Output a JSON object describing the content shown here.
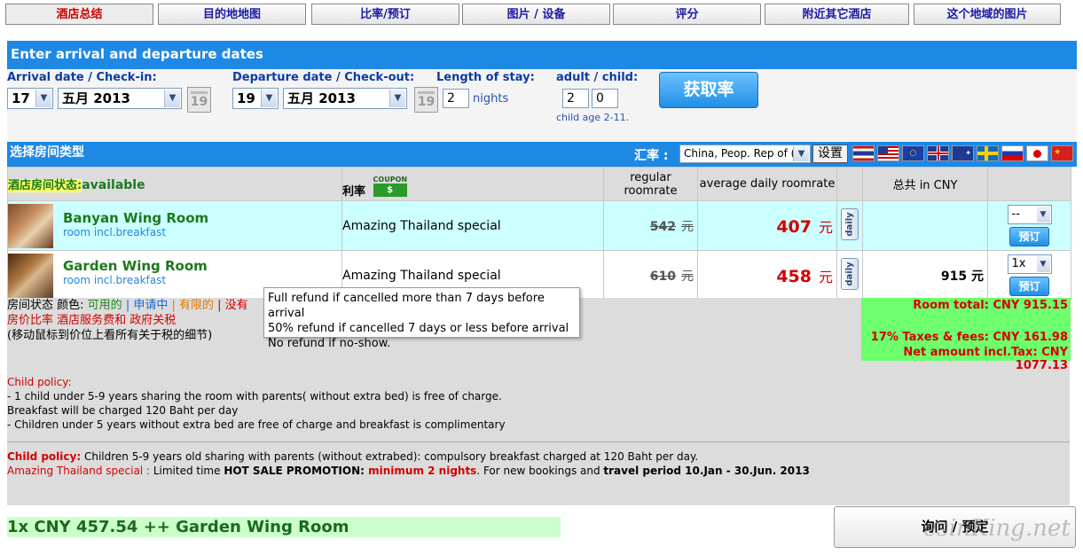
{
  "tabs": [
    "酒店总结",
    "目的地地图",
    "比率/预订",
    "图片 / 设备",
    "评分",
    "附近其它酒店",
    "这个地域的图片"
  ],
  "dates_header": "Enter arrival and departure dates",
  "arrival": {
    "label": "Arrival date / Check-in:",
    "day": "17",
    "month_year": "五月 2013",
    "cal_day": "19"
  },
  "departure": {
    "label": "Departure date / Check-out:",
    "day": "19",
    "month_year": "五月 2013",
    "cal_day": "19"
  },
  "stay": {
    "label": "Length of stay:",
    "value": "2",
    "unit": "nights"
  },
  "guests": {
    "label": "adult / child:",
    "adults": "2",
    "children": "0",
    "note": "child age 2-11."
  },
  "get_rate_button": "获取率",
  "room_type_header": "选择房间类型",
  "currency": {
    "label": "汇率 :",
    "selected": "China, Peop. Rep of (¥)",
    "set_button": "设置"
  },
  "table": {
    "status_label": "酒店房间状态:",
    "status_value": "available",
    "rate_label": "利率",
    "coupon": "COUPON",
    "regular": "regular roomrate",
    "average": "average daily roomrate",
    "total": "总共  in CNY"
  },
  "rooms": [
    {
      "name": "Banyan Wing Room",
      "sub": "room incl.breakfast",
      "rate": "Amazing Thailand special",
      "regular": "542",
      "currency_unit": "元",
      "avg": "407",
      "daily": "daily",
      "total": "",
      "qty": "--",
      "book": "预订"
    },
    {
      "name": "Garden Wing Room",
      "sub": "room incl.breakfast",
      "rate": "Amazing Thailand special",
      "regular": "610",
      "currency_unit": "元",
      "avg": "458",
      "daily": "daily",
      "total": "915 元",
      "qty": "1x",
      "book": "预订"
    }
  ],
  "legend": {
    "status": "房间状态 颜色:",
    "available": "可用的",
    "request": "| 申请中",
    "limited": "| 有限的",
    "none": "| 没有",
    "line2": "房价比率 酒店服务费和 政府关税",
    "line3": "(移动鼠标到价位上看所有关于税的细节)"
  },
  "tooltip": [
    "Full refund if cancelled more than 7 days before arrival",
    "50% refund if cancelled 7 days or less before arrival",
    "No refund if no-show."
  ],
  "totals": {
    "room_total": "Room total: CNY 915.15",
    "taxes": "17% Taxes & fees: CNY 161.98",
    "net": "Net amount incl.Tax: CNY 1077.13"
  },
  "child_policy": {
    "title": "Child policy:",
    "lines": [
      "- 1 child under 5-9 years sharing the room with parents( without extra bed) is free of charge.",
      "Breakfast will be charged 120 Baht per day",
      "- Children under 5 years without extra bed are free of charge and breakfast is complimentary"
    ]
  },
  "policy2": {
    "label": "Child policy:",
    "text": " Children 5-9 years old sharing with parents (without extrabed): compulsory breakfast charged at 120 Baht per day.",
    "promo_label": "Amazing Thailand special :",
    "promo_a": " Limited time ",
    "promo_b": "HOT SALE PROMOTION:",
    "promo_c": " minimum 2 nights",
    "promo_d": ". For new bookings and ",
    "promo_e": "travel period 10.Jan - 30.Jun. 2013"
  },
  "summary": "1x CNY 457.54 ++ Garden Wing Room",
  "reserve_button": "询问 / 预定",
  "watermark": "esinKing.net"
}
